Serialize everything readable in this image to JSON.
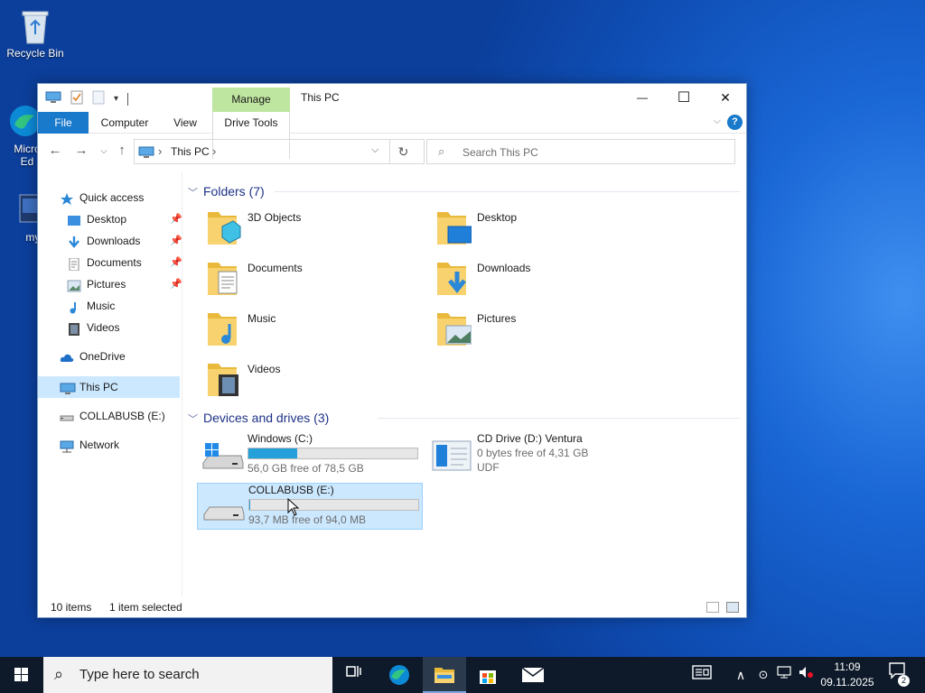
{
  "desktop": {
    "icons": [
      {
        "label": "Recycle Bin",
        "icon": "recycle-bin-icon"
      },
      {
        "label": "Micro Ed",
        "icon": "edge-icon"
      },
      {
        "label": "myf",
        "icon": "file-icon"
      }
    ]
  },
  "window": {
    "title": "This PC",
    "context_tab": "Manage",
    "ribbon_tabs": [
      "File",
      "Computer",
      "View",
      "Drive Tools"
    ],
    "controls": {
      "minimize": "—",
      "maximize": "☐",
      "close": "✕"
    }
  },
  "address": {
    "crumb": "This PC",
    "search_placeholder": "Search This PC"
  },
  "navigation": {
    "quick_access": "Quick access",
    "pinned": [
      {
        "label": "Desktop",
        "pinned": true,
        "icon": "desktop-folder-icon"
      },
      {
        "label": "Downloads",
        "pinned": true,
        "icon": "downloads-icon"
      },
      {
        "label": "Documents",
        "pinned": true,
        "icon": "documents-icon"
      },
      {
        "label": "Pictures",
        "pinned": true,
        "icon": "pictures-icon"
      },
      {
        "label": "Music",
        "pinned": false,
        "icon": "music-icon"
      },
      {
        "label": "Videos",
        "pinned": false,
        "icon": "videos-icon"
      }
    ],
    "onedrive": "OneDrive",
    "this_pc": "This PC",
    "usb": "COLLABUSB (E:)",
    "network": "Network",
    "selected": "This PC"
  },
  "content": {
    "folders_header": "Folders (7)",
    "folders": [
      {
        "name": "3D Objects",
        "icon": "3d-objects-folder-icon"
      },
      {
        "name": "Desktop",
        "icon": "desktop-folder-icon"
      },
      {
        "name": "Documents",
        "icon": "documents-folder-icon"
      },
      {
        "name": "Downloads",
        "icon": "downloads-folder-icon"
      },
      {
        "name": "Music",
        "icon": "music-folder-icon"
      },
      {
        "name": "Pictures",
        "icon": "pictures-folder-icon"
      },
      {
        "name": "Videos",
        "icon": "videos-folder-icon"
      }
    ],
    "drives_header": "Devices and drives (3)",
    "drives": [
      {
        "name": "Windows (C:)",
        "free": "56,0 GB free of 78,5 GB",
        "used_fraction": 0.29,
        "icon": "windows-drive-icon",
        "selected": false
      },
      {
        "name": "CD Drive (D:) Ventura",
        "free": "0 bytes free of 4,31 GB",
        "fs": "UDF",
        "icon": "cd-drive-icon",
        "selected": false
      },
      {
        "name": "COLLABUSB (E:)",
        "free": "93,7 MB free of 94,0 MB",
        "used_fraction": 0.003,
        "icon": "usb-drive-icon",
        "selected": true
      }
    ]
  },
  "status": {
    "items": "10 items",
    "selected": "1 item selected"
  },
  "taskbar": {
    "search_placeholder": "Type here to search",
    "time": "11:09",
    "date": "09.11.2025",
    "notification_count": "2",
    "apps": [
      "task-view-icon",
      "edge-icon",
      "file-explorer-icon",
      "store-icon",
      "mail-icon"
    ]
  },
  "colors": {
    "accent": "#1979ca",
    "selection": "#cce8ff",
    "manage_tab": "#bfe6a0",
    "drive_bar": "#26a0da",
    "group_header": "#1e3287"
  }
}
